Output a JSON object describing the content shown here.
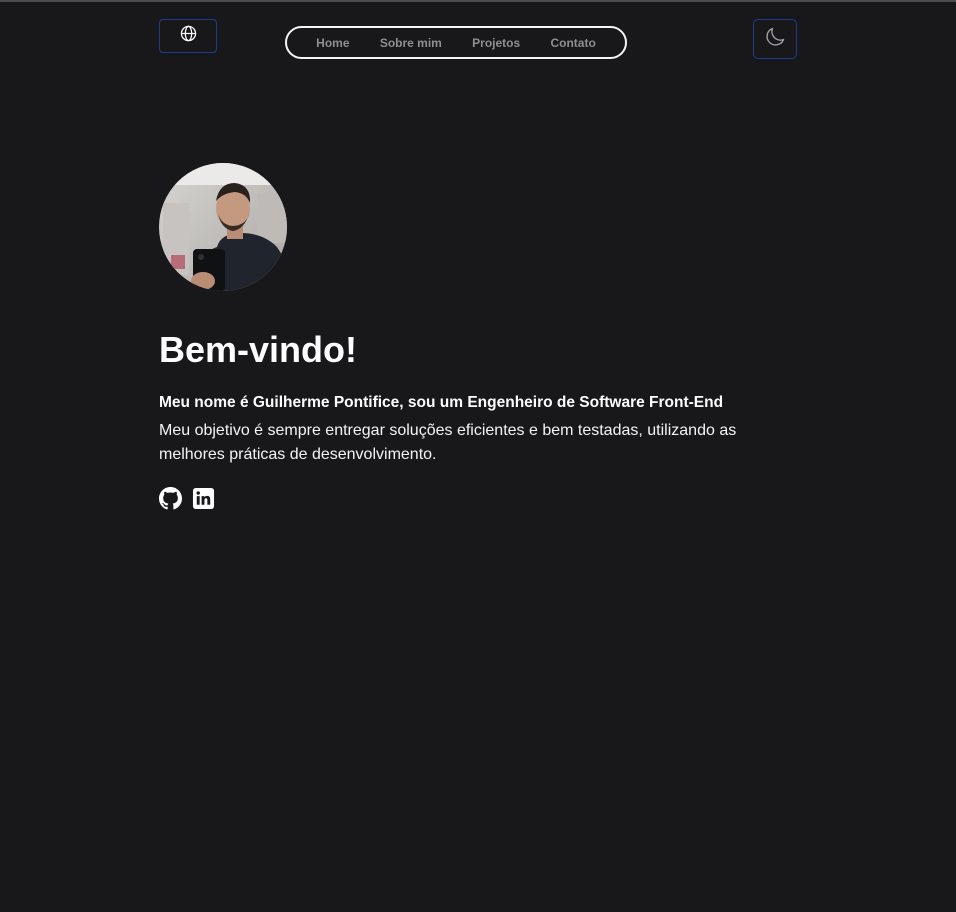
{
  "header": {
    "language_button": {
      "icon": "globe-icon"
    },
    "nav": [
      {
        "label": "Home"
      },
      {
        "label": "Sobre mim"
      },
      {
        "label": "Projetos"
      },
      {
        "label": "Contato"
      }
    ],
    "theme_button": {
      "icon": "moon-icon"
    }
  },
  "hero": {
    "avatar_alt": "Guilherme Pontifice",
    "title": "Bem-vindo!",
    "intro": "Meu nome é Guilherme Pontifice, sou um Engenheiro de Software Front-End",
    "objective": "Meu objetivo é sempre entregar soluções eficientes e bem testadas, utilizando as melhores práticas de desenvolvimento.",
    "socials": [
      {
        "icon": "github-icon"
      },
      {
        "icon": "linkedin-icon"
      }
    ]
  },
  "colors": {
    "background": "#18181b",
    "text": "#ffffff",
    "nav_text": "#8e8e93",
    "button_border": "#1e3a8a"
  }
}
